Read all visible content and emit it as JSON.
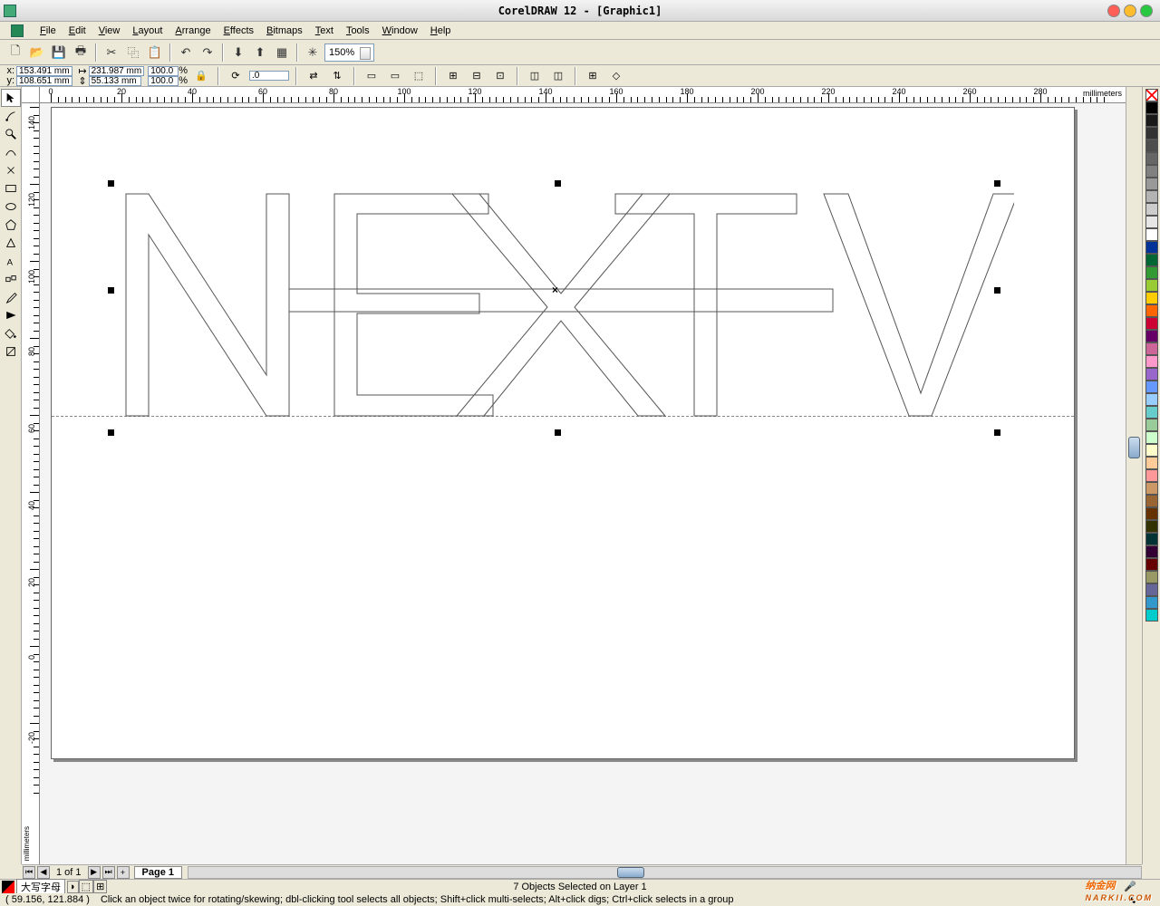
{
  "title": "CorelDRAW 12 - [Graphic1]",
  "menus": [
    "File",
    "Edit",
    "View",
    "Layout",
    "Arrange",
    "Effects",
    "Bitmaps",
    "Text",
    "Tools",
    "Window",
    "Help"
  ],
  "zoom": "150%",
  "props": {
    "x": "153.491 mm",
    "y": "108.651 mm",
    "w": "231.987 mm",
    "h": "55.133 mm",
    "sx": "100.0",
    "sy": "100.0",
    "pct": "%",
    "rot": ".0"
  },
  "ruler_h": [
    0,
    20,
    40,
    60,
    80,
    100,
    120,
    140,
    160,
    180,
    200,
    220,
    240,
    260,
    280
  ],
  "ruler_v": [
    140,
    120,
    100,
    80,
    60,
    40,
    20,
    0,
    -20
  ],
  "ruler_unit": "millimeters",
  "page_nav": {
    "count": "1 of 1",
    "tab": "Page 1"
  },
  "status": {
    "caps": "大写字母",
    "sel": "7 Objects Selected on Layer 1",
    "coord": "( 59.156, 121.884 )",
    "hint": "Click an object twice for rotating/skewing; dbl-clicking tool selects all objects; Shift+click multi-selects; Alt+click digs; Ctrl+click selects in a group"
  },
  "colors": [
    "#000000",
    "#1a1a1a",
    "#333333",
    "#4d4d4d",
    "#666666",
    "#808080",
    "#999999",
    "#b3b3b3",
    "#cccccc",
    "#e6e6e6",
    "#ffffff",
    "#003399",
    "#006633",
    "#339933",
    "#99cc33",
    "#ffcc00",
    "#ff6600",
    "#cc0033",
    "#660066",
    "#cc6699",
    "#ff99cc",
    "#9966cc",
    "#6699ff",
    "#99ccff",
    "#66cccc",
    "#99cc99",
    "#ccffcc",
    "#ffffcc",
    "#ffcc99",
    "#ff9999",
    "#cc9966",
    "#996633",
    "#663300",
    "#333300",
    "#003333",
    "#330033",
    "#660000",
    "#999966",
    "#666699",
    "#3399cc",
    "#00cccc"
  ],
  "brand": {
    "name": "纳金网",
    "sub": "NARKII.COM"
  }
}
